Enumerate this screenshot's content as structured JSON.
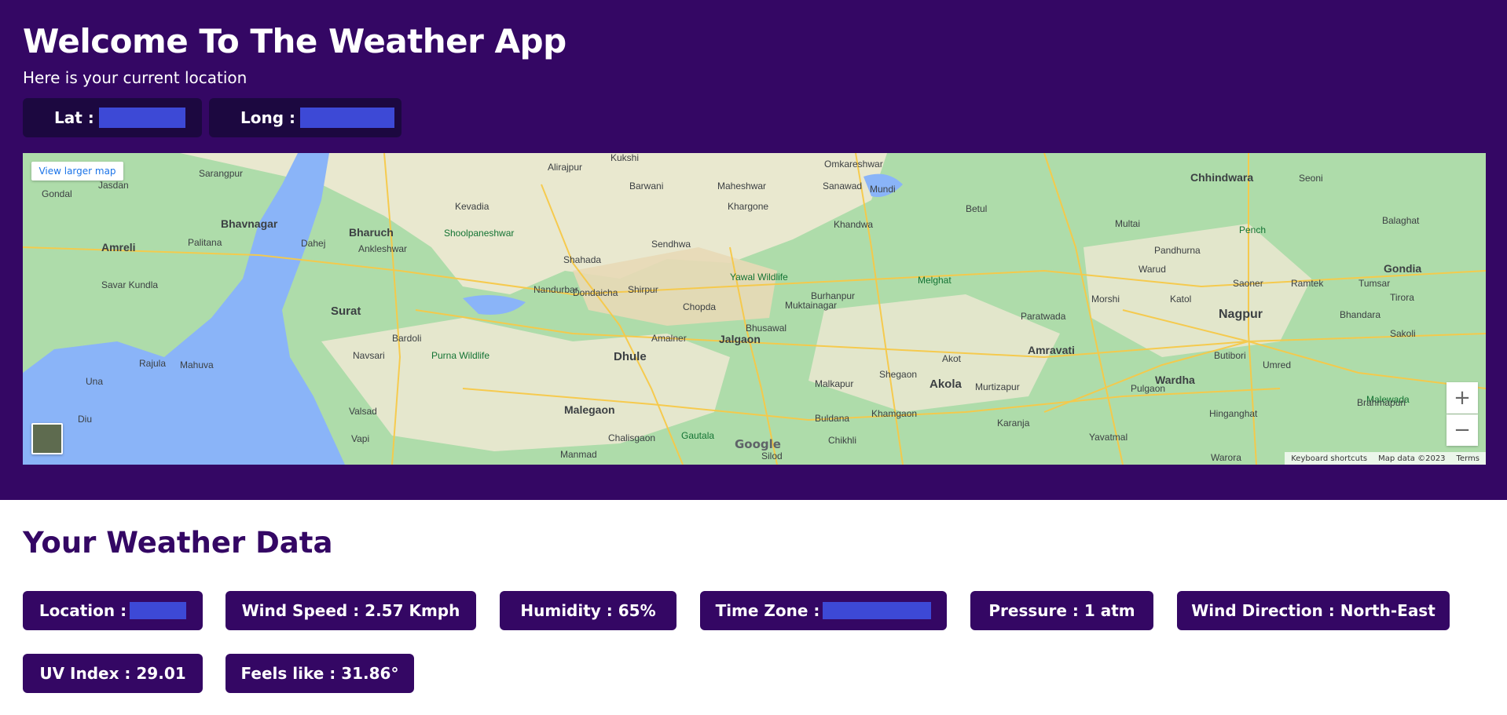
{
  "header": {
    "title": "Welcome To The Weather App",
    "subtitle": "Here is your current location",
    "lat_label": "Lat :",
    "long_label": "Long :"
  },
  "map": {
    "larger_map_label": "View larger map",
    "zoom_in": "+",
    "zoom_out": "−",
    "google_logo": "Google",
    "keyboard_shortcuts": "Keyboard shortcuts",
    "map_data": "Map data ©2023",
    "terms": "Terms",
    "labels": [
      "Amreli",
      "Bhavnagar",
      "Bharuch",
      "Surat",
      "Dhule",
      "Jalgaon",
      "Malegaon",
      "Akola",
      "Amravati",
      "Nagpur",
      "Wardha",
      "Gondia",
      "Chhindwara",
      "Burhanpur",
      "Shoolpaneshwar Wildlife Sanctuary",
      "Yawal Wildlife Sanctuary",
      "Melghat Tiger Reserve",
      "Purna Wildlife Sanctuary",
      "Pench National Park",
      "Gautala Autramghat Sanctuary",
      "Nandurbar",
      "Shirpur",
      "Chopda",
      "Khandwa",
      "Betul",
      "Bardoli",
      "Navsari",
      "Valsad",
      "Diu",
      "Una",
      "Mahuva",
      "Palitana",
      "Ankleshwar",
      "Khargone",
      "Sendhwa",
      "Muktainagar",
      "Bhusawal",
      "Buldana",
      "Khamgaon",
      "Shegaon",
      "Paratwada",
      "Morshi",
      "Warud",
      "Katol",
      "Saoner",
      "Ramtek",
      "Bhandara",
      "Tirora",
      "Tumsar",
      "Pandhurna",
      "Multai",
      "Seoni",
      "Balaghat",
      "Umred",
      "Hinganghat",
      "Pulgaon",
      "Yavatmal",
      "Karanja",
      "Murtizapur",
      "Akot",
      "Malkapur",
      "Chikhli",
      "Silod",
      "Chalisgaon",
      "Manmad",
      "Amalner",
      "Dondaicha",
      "Shahada",
      "Barwani",
      "Kukshi",
      "Alirajpur",
      "Kevadia",
      "Rajula",
      "Savar Kundla",
      "Jasdan",
      "Sarangpur",
      "Gondal",
      "Dahej",
      "Vapi",
      "Mundi",
      "Sanawad",
      "Maheshwar",
      "Omkareshwar",
      "Brahmapuri",
      "Sakoli",
      "Butibori",
      "Warora",
      "Malewada Forest Range"
    ]
  },
  "weather": {
    "section_title": "Your Weather Data",
    "location_label": "Location :",
    "wind_speed": "Wind Speed : 2.57 Kmph",
    "humidity": "Humidity : 65%",
    "time_zone_label": "Time Zone :",
    "pressure": "Pressure : 1 atm",
    "wind_direction": "Wind Direction : North-East",
    "uv_index": "UV Index : 29.01",
    "feels_like": "Feels like : 31.86°"
  },
  "colors": {
    "primary": "#340764",
    "coord_box": "#1c0840",
    "redaction": "#3d49d6",
    "white": "#ffffff"
  }
}
